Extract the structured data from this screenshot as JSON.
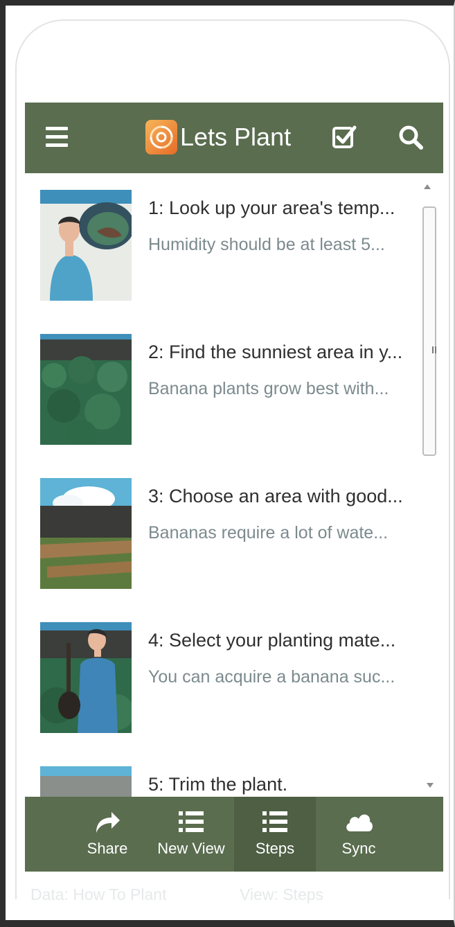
{
  "header": {
    "title": "Lets Plant",
    "menu_icon": "hamburger-menu-icon",
    "logo_icon": "app-logo-icon",
    "check_icon": "checkbox-icon",
    "search_icon": "search-icon"
  },
  "steps": [
    {
      "title": "1: Look up your area's temp...",
      "description": "Humidity should be at least 5...",
      "thumbnail": "person-thinking-of-earth"
    },
    {
      "title": "2: Find the sunniest area in y...",
      "description": "Banana plants grow best with...",
      "thumbnail": "green-garden-soil"
    },
    {
      "title": "3: Choose an area with good...",
      "description": "Bananas require a lot of wate...",
      "thumbnail": "dug-garden-rows-under-sky"
    },
    {
      "title": "4: Select your planting mate...",
      "description": "You can acquire a banana suc...",
      "thumbnail": "man-holding-plant"
    },
    {
      "title": "5: Trim the plant.",
      "description": "",
      "thumbnail": "plant-trimming"
    }
  ],
  "bottom_nav": [
    {
      "label": "Share",
      "icon": "share-arrow-icon",
      "active": false
    },
    {
      "label": "New View",
      "icon": "list-icon",
      "active": false
    },
    {
      "label": "Steps",
      "icon": "list-icon",
      "active": true
    },
    {
      "label": "Sync",
      "icon": "cloud-icon",
      "active": false
    }
  ],
  "footer": {
    "data_label": "Data: How To Plant",
    "view_label": "View: Steps"
  },
  "colors": {
    "header_bg": "#5a6d4f",
    "active_tab_bg": "#4e5f44",
    "title_text": "#2f2f2f",
    "description_text": "#7c8a8e"
  }
}
